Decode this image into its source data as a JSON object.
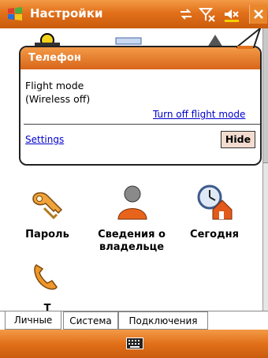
{
  "window": {
    "title": "Настройки"
  },
  "status_icons": [
    "sync-icon",
    "signal-off-icon",
    "speaker-off-icon",
    "battery-icon"
  ],
  "notification": {
    "title": "Телефон",
    "message_line1": "Flight mode",
    "message_line2": "(Wireless off)",
    "action_link": "Turn off flight mode",
    "settings_link": "Settings",
    "hide_button": "Hide"
  },
  "apps": [
    {
      "label_line1": "Пароль",
      "label_line2": "",
      "icon": "keys-icon"
    },
    {
      "label_line1": "Сведения о",
      "label_line2": "владельце",
      "icon": "owner-info-icon"
    },
    {
      "label_line1": "Сегодня",
      "label_line2": "",
      "icon": "today-icon"
    },
    {
      "label_line1": "Т",
      "label_line2": "",
      "icon": "phone-icon"
    }
  ],
  "tabs": [
    "Личные",
    "Система",
    "Подключения"
  ],
  "active_tab": "Личные",
  "colors": {
    "accent": "#e2701a",
    "link": "#0000cc"
  }
}
